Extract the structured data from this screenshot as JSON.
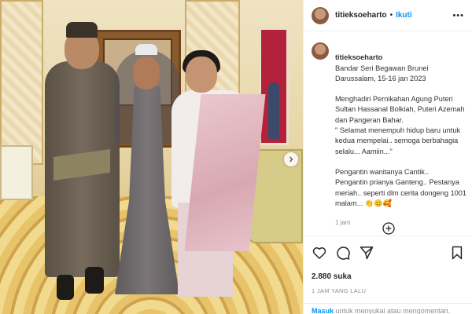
{
  "post": {
    "username": "titieksoeharto",
    "follow_label": "Ikuti",
    "more_label": "•••",
    "caption": {
      "location": "Bandar Seri Begawan Brunei Darussalam, 15-16 jan 2023",
      "paragraph1": "Menghadiri Pernikahan Agung Puteri Sultan Hassanal Bolkiah, Puteri Azemah dan Pangeran Bahar.\n\" Selamat menempuh hidup baru untuk kedua mempelai.. semoga berbahagia selalu... Aamiin...\"",
      "paragraph2": "Pengantin wanitanya Cantik..\nPengantin prianya Ganteng.. Pestanya meriah.. seperti dlm cerita dongeng 1001 malam... 👏😊🥰",
      "time": "1 jam"
    },
    "likes": "2.880 suka",
    "date": "1 JAM YANG LALU",
    "login_prompt": {
      "login_label": "Masuk",
      "rest": " untuk menyukai atau mengomentari."
    }
  },
  "icons": {
    "like": "heart-icon",
    "comment": "comment-icon",
    "share": "share-icon",
    "save": "bookmark-icon",
    "next": "chevron-right-icon",
    "load_more": "plus-circle-icon",
    "more": "more-icon"
  },
  "colors": {
    "link": "#0095f6",
    "text": "#262626",
    "muted": "#8e8e8e"
  }
}
